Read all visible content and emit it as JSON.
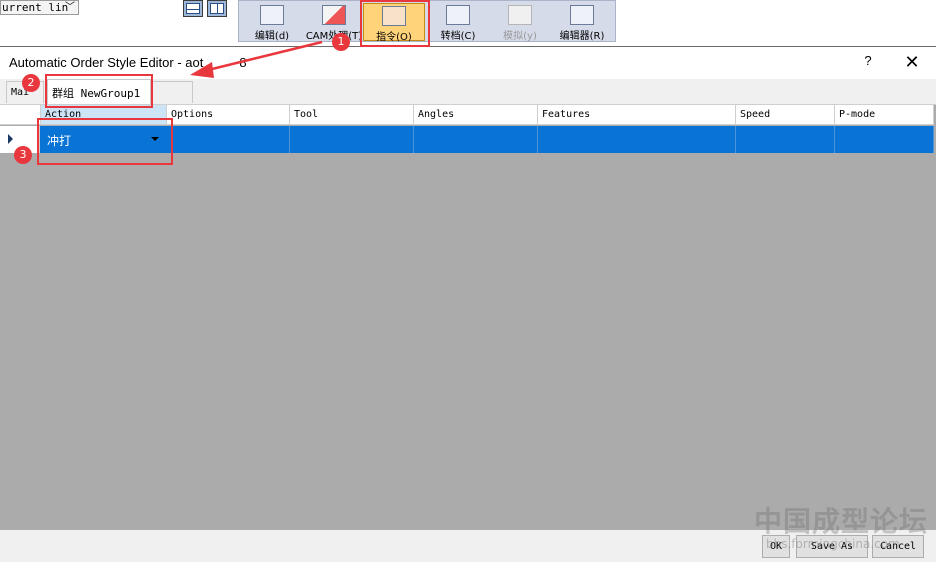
{
  "background_app": {
    "dropdown_value": "urrent lin",
    "layout_buttons": [
      "horizontal-split-icon",
      "vertical-split-icon"
    ],
    "toolbar": [
      {
        "label": "编辑(d)",
        "icon": "edit-icon",
        "state": "normal"
      },
      {
        "label": "CAM处理(T)",
        "icon": "cam-process-icon",
        "state": "normal"
      },
      {
        "label": "指令(O)",
        "icon": "instruction-icon",
        "state": "active"
      },
      {
        "label": "转档(C)",
        "icon": "convert-icon",
        "state": "normal"
      },
      {
        "label": "模拟(y)",
        "icon": "simulate-icon",
        "state": "disabled"
      },
      {
        "label": "编辑器(R)",
        "icon": "editor-icon",
        "state": "normal"
      }
    ]
  },
  "dialog": {
    "title": "Automatic Order Style Editor - aot",
    "title_suffix": "8",
    "help": "?",
    "close": "✕",
    "tabs": [
      {
        "label": "Mai",
        "active": false
      },
      {
        "label": "群组 NewGroup1",
        "active": true
      },
      {
        "label": "",
        "active": false
      }
    ],
    "grid": {
      "columns": [
        "Action",
        "Options",
        "Tool",
        "Angles",
        "Features",
        "Speed",
        "P-mode"
      ],
      "rows": [
        {
          "Action": "冲打",
          "Options": "",
          "Tool": "",
          "Angles": "",
          "Features": "",
          "Speed": "",
          "P-mode": "",
          "selected": true
        }
      ]
    },
    "buttons": {
      "ok": "OK",
      "save_as": "Save As",
      "cancel": "Cancel"
    }
  },
  "annotations": {
    "highlight_color": "#e8383d",
    "badges": [
      "1",
      "2",
      "3"
    ]
  },
  "watermark": {
    "text": "中国成型论坛",
    "url": "bbs.formingchina.com"
  },
  "colors": {
    "selection_blue": "#0a74d6",
    "grid_gray": "#ababab",
    "toolbar_bg": "#d6dbe9",
    "active_tool": "#ffd37a"
  }
}
